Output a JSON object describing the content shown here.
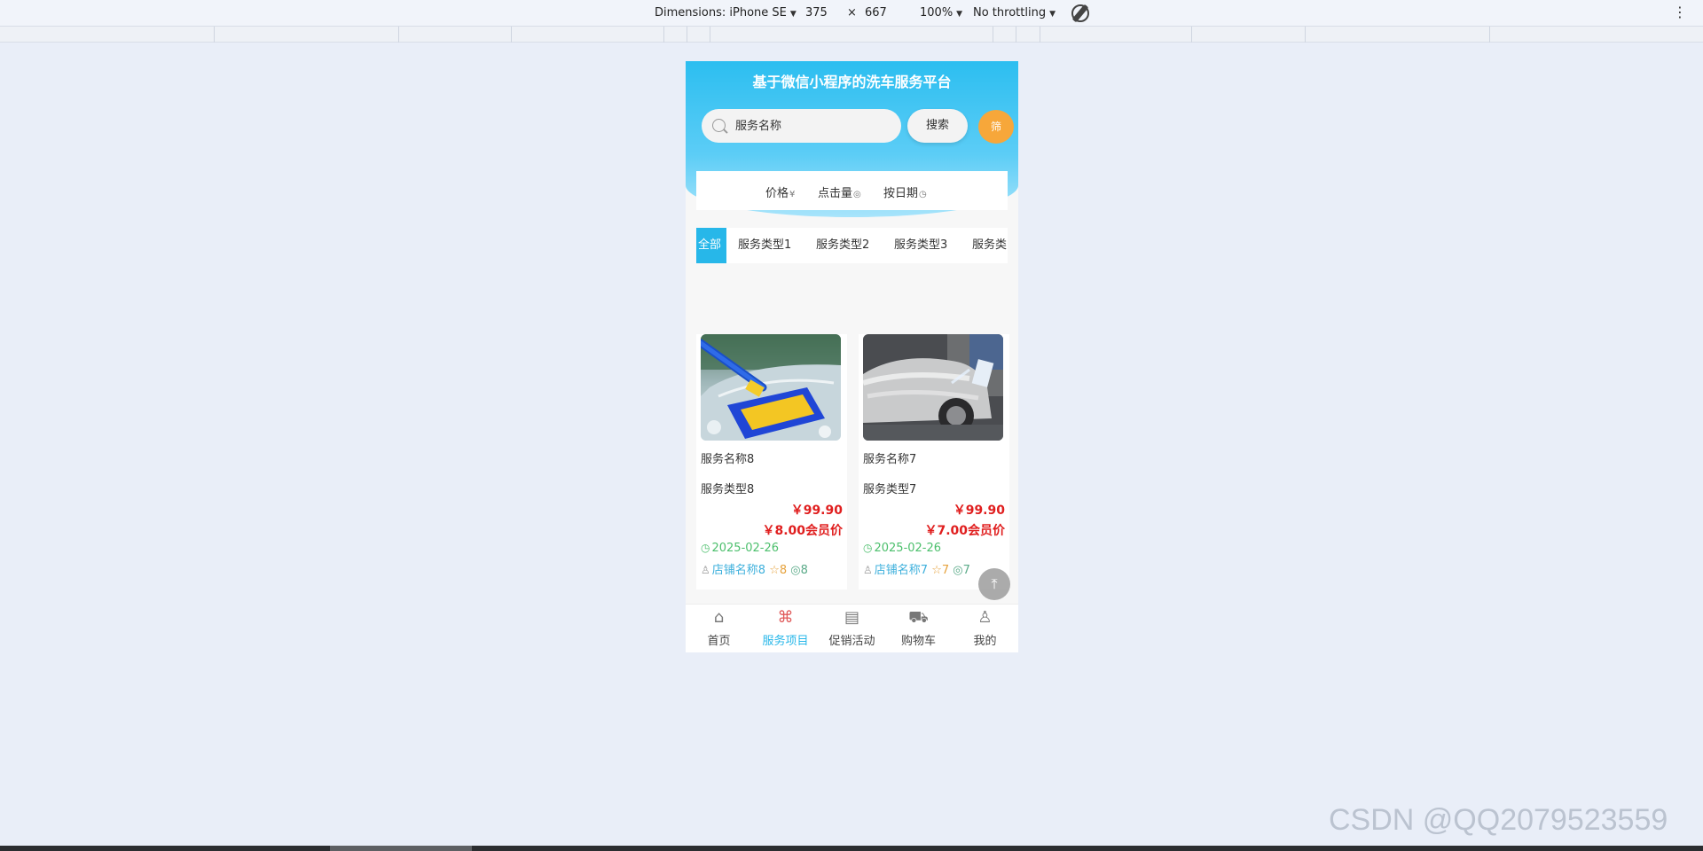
{
  "devtools": {
    "dimensions_label": "Dimensions: iPhone SE",
    "width": "375",
    "times": "×",
    "height": "667",
    "zoom": "100%",
    "throttle": "No throttling"
  },
  "app": {
    "title": "基于微信小程序的洗车服务平台",
    "search": {
      "placeholder": "服务名称",
      "button": "搜索",
      "filter_button": "筛"
    },
    "sort": [
      {
        "label": "价格",
        "icon": "¥"
      },
      {
        "label": "点击量",
        "icon": "◎"
      },
      {
        "label": "按日期",
        "icon": "◷"
      }
    ],
    "categories": [
      "全部",
      "服务类型1",
      "服务类型2",
      "服务类型3",
      "服务类"
    ],
    "products": [
      {
        "name": "服务名称8",
        "type": "服务类型8",
        "price": "￥99.90",
        "vip_price": "￥8.00会员价",
        "date": "2025-02-26",
        "shop": "店铺名称8",
        "stars": "8",
        "views": "8",
        "image": "car-wash-brush"
      },
      {
        "name": "服务名称7",
        "type": "服务类型7",
        "price": "￥99.90",
        "vip_price": "￥7.00会员价",
        "date": "2025-02-26",
        "shop": "店铺名称7",
        "stars": "7",
        "views": "7",
        "image": "foam-car-wash"
      }
    ],
    "tabs": [
      {
        "label": "首页",
        "icon": "home-icon"
      },
      {
        "label": "服务项目",
        "icon": "clover-icon"
      },
      {
        "label": "促销活动",
        "icon": "calendar-icon"
      },
      {
        "label": "购物车",
        "icon": "cart-icon"
      },
      {
        "label": "我的",
        "icon": "user-icon"
      }
    ],
    "active_tab": 1
  },
  "watermark": "CSDN @QQ2079523559",
  "colors": {
    "primary": "#27b7e9",
    "price": "#e01e1e",
    "filter": "#f7a73a",
    "date": "#4cbf6c"
  }
}
